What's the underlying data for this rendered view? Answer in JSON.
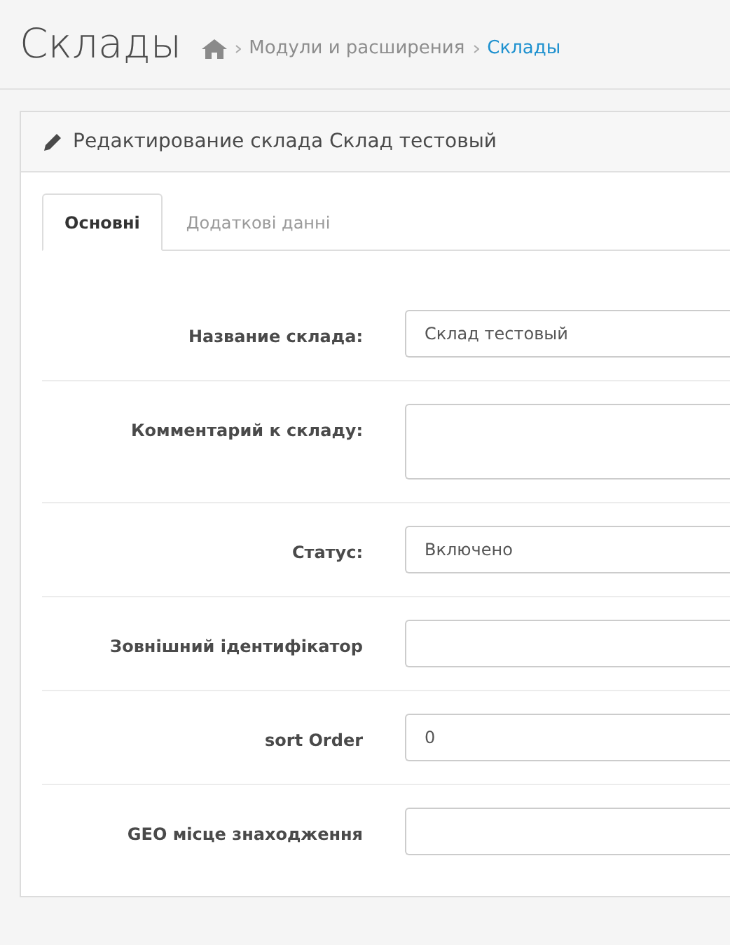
{
  "page_title": "Склады",
  "breadcrumbs": [
    {
      "label": "Модули и расширения",
      "current": false
    },
    {
      "label": "Склады",
      "current": true
    }
  ],
  "panel": {
    "title": "Редактирование склада Склад тестовый"
  },
  "tabs": [
    {
      "label": "Основні",
      "selected": true
    },
    {
      "label": "Додаткові данні",
      "selected": false
    }
  ],
  "fields": [
    {
      "label": "Название склада:",
      "kind": "input",
      "value": "Склад тестовый"
    },
    {
      "label": "Комментарий к складу:",
      "kind": "textarea"
    },
    {
      "label": "Статус:",
      "kind": "select",
      "value": "Включено"
    },
    {
      "label": "Зовнішний ідентифікатор",
      "kind": "input"
    },
    {
      "label": "sort Order",
      "kind": "input",
      "value": "0"
    },
    {
      "label": "GEO місце знаходження",
      "kind": "input"
    }
  ]
}
